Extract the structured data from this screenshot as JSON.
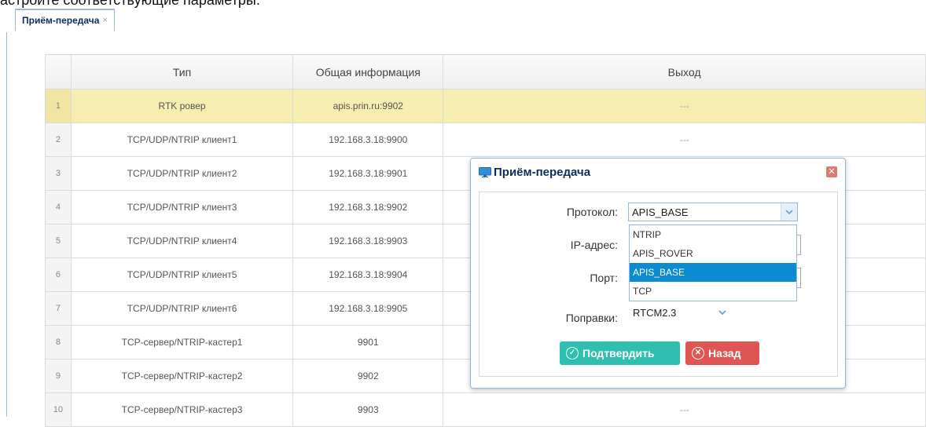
{
  "top_caption": "астройте соответствующие параметры.",
  "tab": {
    "label": "Приём-передача",
    "close": "×"
  },
  "grid": {
    "headers": [
      "",
      "Тип",
      "Общая информация",
      "Выход"
    ],
    "rows": [
      {
        "num": "1",
        "type": "RTK ровер",
        "info": "apis.prin.ru:9902",
        "out": "---"
      },
      {
        "num": "2",
        "type": "TCP/UDP/NTRIP клиент1",
        "info": "192.168.3.18:9900",
        "out": "---"
      },
      {
        "num": "3",
        "type": "TCP/UDP/NTRIP клиент2",
        "info": "192.168.3.18:9901",
        "out": ""
      },
      {
        "num": "4",
        "type": "TCP/UDP/NTRIP клиент3",
        "info": "192.168.3.18:9902",
        "out": ""
      },
      {
        "num": "5",
        "type": "TCP/UDP/NTRIP клиент4",
        "info": "192.168.3.18:9903",
        "out": ""
      },
      {
        "num": "6",
        "type": "TCP/UDP/NTRIP клиент5",
        "info": "192.168.3.18:9904",
        "out": ""
      },
      {
        "num": "7",
        "type": "TCP/UDP/NTRIP клиент6",
        "info": "192.168.3.18:9905",
        "out": ""
      },
      {
        "num": "8",
        "type": "TCP-сервер/NTRIP-кастер1",
        "info": "9901",
        "out": ""
      },
      {
        "num": "9",
        "type": "TCP-сервер/NTRIP-кастер2",
        "info": "9902",
        "out": ""
      },
      {
        "num": "10",
        "type": "TCP-сервер/NTRIP-кастер3",
        "info": "9903",
        "out": "---"
      }
    ]
  },
  "dialog": {
    "title": "Приём-передача",
    "protocol_label": "Протокол:",
    "protocol_value": "APIS_BASE",
    "ip_label": "IP-адрес:",
    "port_label": "Порт:",
    "corrections_label": "Поправки:",
    "corrections_value": "RTCM2.3",
    "options": [
      "NTRIP",
      "APIS_ROVER",
      "APIS_BASE",
      "TCP"
    ],
    "confirm_label": "Подтвердить",
    "back_label": "Назад"
  },
  "colors": {
    "accent": "#95b8e7",
    "selected_row": "#f6edb0",
    "confirm": "#2ebfb1",
    "back": "#e15454",
    "dropdown_sel": "#0b8bd0"
  }
}
